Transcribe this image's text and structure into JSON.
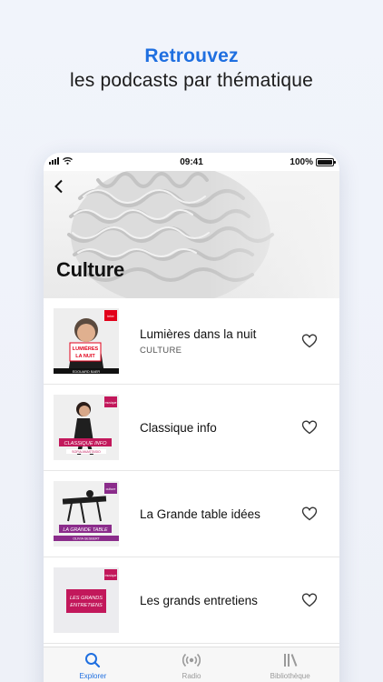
{
  "promo": {
    "headline_accent": "Retrouvez",
    "headline": "les podcasts par thématique"
  },
  "status_bar": {
    "time": "09:41",
    "battery": "100%"
  },
  "header": {
    "title": "Culture",
    "back_icon": "chevron-left-icon"
  },
  "podcasts": [
    {
      "title": "Lumières dans la nuit",
      "category": "CULTURE",
      "cover": {
        "text": "LUMIÈRES LA NUIT",
        "host": "EDOUARD BAER",
        "brand": "france inter",
        "color": "#e2001a"
      }
    },
    {
      "title": "Classique info",
      "category": "",
      "cover": {
        "text": "CLASSIQUE INFO",
        "host": "SOFIA ANASTASIO",
        "brand": "france musique",
        "color": "#c2185b"
      }
    },
    {
      "title": "La Grande table idées",
      "category": "",
      "cover": {
        "text": "LA GRANDE TABLE",
        "host": "OLIVIA GESBERT",
        "brand": "france culture",
        "color": "#8b2c8b"
      }
    },
    {
      "title": "Les grands entretiens",
      "category": "",
      "cover": {
        "text": "LES GRANDS ENTRETIENS",
        "host": "",
        "brand": "france musique",
        "color": "#c2185b"
      }
    }
  ],
  "tabs": [
    {
      "label": "Explorer",
      "icon": "search-icon",
      "active": true
    },
    {
      "label": "Radio",
      "icon": "radio-icon",
      "active": false
    },
    {
      "label": "Bibliothèque",
      "icon": "library-icon",
      "active": false
    }
  ],
  "colors": {
    "accent": "#1f6fe0",
    "inter_red": "#e2001a",
    "musique_pink": "#c2185b",
    "culture_purple": "#8b2c8b"
  }
}
